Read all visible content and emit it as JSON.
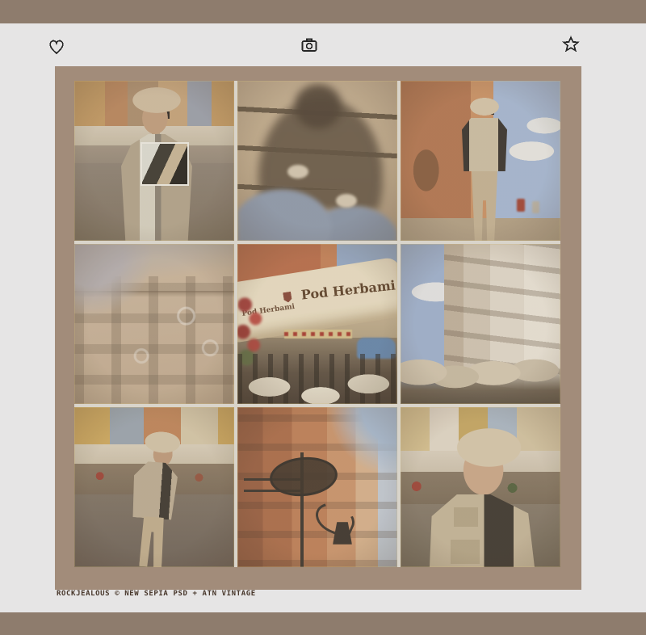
{
  "theme": {
    "page_bg": "#e6e5e5",
    "bar_color": "#8e7c6d",
    "frame_color": "#a28c7a",
    "grid_gap_color": "#d9d4ca",
    "icon_color": "#262626",
    "caption_color": "#47362a"
  },
  "toolbar": {
    "icons": [
      {
        "name": "heart"
      },
      {
        "name": "camera"
      },
      {
        "name": "star"
      }
    ]
  },
  "gallery": {
    "rows": 3,
    "cols": 3,
    "photos": [
      {
        "desc": "Woman in beret and sunglasses opening her cardigan in Warsaw Old Town square, with a white-framed zoom inset over her hand"
      },
      {
        "desc": "Shadow self-portrait looking down at white sneakers and blue jeans on sunlit steps"
      },
      {
        "desc": "Woman in beige vest glancing back while walking down an orange-walled Old Town street"
      },
      {
        "desc": "Ornate baroque palace facade with soap bubbles floating in front"
      },
      {
        "desc": "Cafe terrace under a cream Pod Herbami umbrella with red flowers, wicker chairs and a blue car",
        "labels": [
          "Pod Herbami",
          "Pod Herbami"
        ]
      },
      {
        "desc": "Row of pastel townhouses with cafe umbrellas under a blue sky"
      },
      {
        "desc": "Woman in beret strolling across the market square past white market umbrellas"
      },
      {
        "desc": "Looking up at terracotta facades with a wrought-iron shop sign and lantern"
      },
      {
        "desc": "Portrait of woman in beret, sunglasses and beige utility vest standing in the market square"
      }
    ]
  },
  "caption": {
    "text": "ROCKJEALOUS © NEW SEPIA PSD + ATN VINTAGE"
  }
}
